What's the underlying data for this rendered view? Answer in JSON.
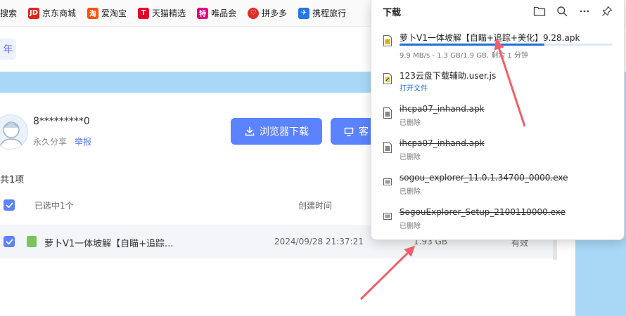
{
  "bookmarks": [
    {
      "label": "搜索",
      "icon": "search-bookmark-icon",
      "color": "#ffffff",
      "glyph": ""
    },
    {
      "label": "京东商城",
      "icon": "jd-icon",
      "color": "#e1251b",
      "glyph": "JD"
    },
    {
      "label": "爱淘宝",
      "icon": "taobao-icon",
      "color": "#ff5000",
      "glyph": "淘"
    },
    {
      "label": "天猫精选",
      "icon": "tmall-icon",
      "color": "#e4002b",
      "glyph": "T"
    },
    {
      "label": "唯品会",
      "icon": "vip-icon",
      "color": "#e5007f",
      "glyph": "特"
    },
    {
      "label": "拼多多",
      "icon": "pinduoduo-icon",
      "color": "#e02e24",
      "glyph": "♡"
    },
    {
      "label": "携程旅行",
      "icon": "ctrip-icon",
      "color": "#2577e3",
      "glyph": "✈"
    }
  ],
  "page": {
    "year_tab": "年",
    "user_name": "8*********0",
    "share_type": "永久分享",
    "report": "举报",
    "browser_download": "浏览器下载",
    "client_download": "客",
    "total": "共1项",
    "selected": "已选中1个",
    "created_header": "创建时间",
    "file": {
      "name": "萝卜V1一体坡解【自瞄+追踪...",
      "created": "2024/09/28 21:37:21",
      "size": "1.93 GB",
      "validity": "有效"
    }
  },
  "downloads": {
    "title": "下载",
    "items": [
      {
        "name": "萝卜V1一体坡解【自瞄+追踪+美化】9.28.apk",
        "status": "9.9 MB/s - 1.3 GB/1.9 GB, 剩余 1 分钟",
        "progress": 0.68,
        "deleted": false,
        "type": "apk"
      },
      {
        "name": "123云盘下载辅助.user.js",
        "status": "打开文件",
        "deleted": false,
        "type": "js"
      },
      {
        "name": "ihcpa07_inhand.apk",
        "status": "已删除",
        "deleted": true,
        "type": "apk"
      },
      {
        "name": "ihcpa07_inhand.apk",
        "status": "已删除",
        "deleted": true,
        "type": "apk"
      },
      {
        "name": "sogou_explorer_11.0.1.34700_0000.exe",
        "status": "已删除",
        "deleted": true,
        "type": "exe"
      },
      {
        "name": "SogouExplorer_Setup_2100110000.exe",
        "status": "已删除",
        "deleted": true,
        "type": "exe"
      }
    ]
  },
  "colors": {
    "accent": "#5b82ff",
    "progress": "#1a6fe0",
    "annotation_arrow": "#f0606a",
    "banner": "#a9d8f7"
  }
}
